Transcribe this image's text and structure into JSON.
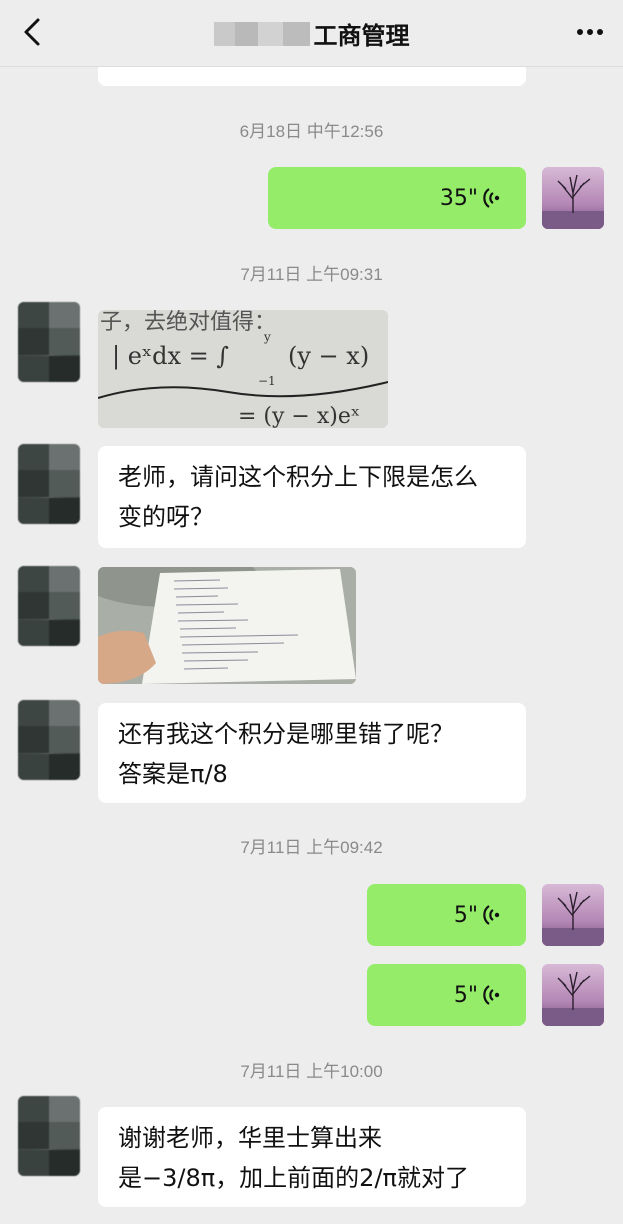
{
  "header": {
    "title": "工商管理",
    "more_label": "···"
  },
  "messages": [
    {
      "type": "timestamp",
      "text": "6月18日 中午12:56"
    },
    {
      "type": "voice",
      "side": "right",
      "duration": "35\""
    },
    {
      "type": "timestamp",
      "text": "7月11日 上午09:31"
    },
    {
      "type": "image",
      "side": "left",
      "content": "math-formula-photo"
    },
    {
      "type": "text",
      "side": "left",
      "lines": [
        "老师，请问这个积分上下限是怎么",
        "变的呀？"
      ]
    },
    {
      "type": "image",
      "side": "left",
      "content": "handwritten-notes-photo"
    },
    {
      "type": "text",
      "side": "left",
      "lines": [
        "还有我这个积分是哪里错了呢？",
        "答案是π/8"
      ]
    },
    {
      "type": "timestamp",
      "text": "7月11日 上午09:42"
    },
    {
      "type": "voice",
      "side": "right",
      "duration": "5\""
    },
    {
      "type": "voice",
      "side": "right",
      "duration": "5\""
    },
    {
      "type": "timestamp",
      "text": "7月11日 上午10:00"
    },
    {
      "type": "text",
      "side": "left",
      "lines": [
        "谢谢老师，华里士算出来",
        "是−3/8π，加上前面的2/π就对了"
      ]
    }
  ],
  "math_photo": {
    "line1": "子，去绝对值得：",
    "line2": "| eˣdx = ∫",
    "upper": "y",
    "lower": "−1",
    "line2b": "(y − x)",
    "line3": "= (y − x)eˣ"
  },
  "colors": {
    "background": "#ededed",
    "bubble_self": "#95ec69",
    "bubble_other": "#ffffff",
    "timestamp": "#8a8a8a"
  }
}
